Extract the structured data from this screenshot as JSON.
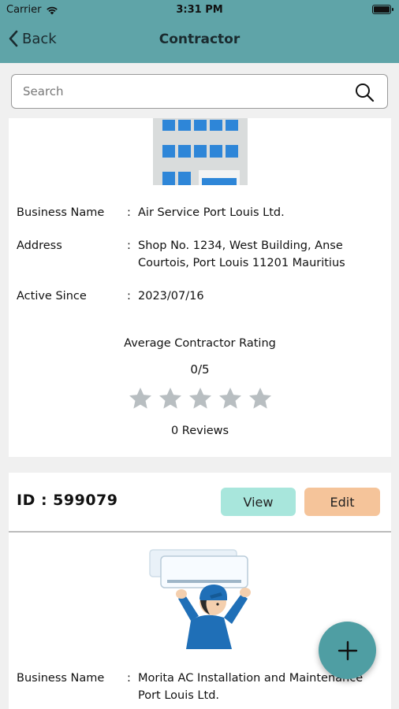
{
  "status_bar": {
    "carrier": "Carrier",
    "time": "3:31 PM"
  },
  "nav": {
    "back_label": "Back",
    "title": "Contractor"
  },
  "search": {
    "placeholder": "Search"
  },
  "contractors": [
    {
      "business_name_label": "Business Name",
      "business_name": "Air Service Port Louis Ltd.",
      "address_label": "Address",
      "address": "Shop No. 1234, West Building, Anse Courtois, Port Louis 11201  Mauritius",
      "active_since_label": "Active Since",
      "active_since": "2023/07/16",
      "rating_title": "Average Contractor Rating",
      "rating_score": "0/5",
      "star_count": 5,
      "stars_filled": 0,
      "reviews": "0 Reviews"
    },
    {
      "id_text": "ID : 599079",
      "view_label": "View",
      "edit_label": "Edit",
      "business_name_label": "Business Name",
      "business_name": "Morita AC Installation and Maintenance Port Louis Ltd."
    }
  ],
  "colors": {
    "header": "#5fa4a8",
    "view_button": "#a8e6dc",
    "edit_button": "#f5c49a",
    "fab": "#4f9ea3",
    "star_empty": "#b8bec1"
  },
  "icons": {
    "search": "search-icon",
    "back": "chevron-left-icon",
    "fab": "plus-icon"
  }
}
